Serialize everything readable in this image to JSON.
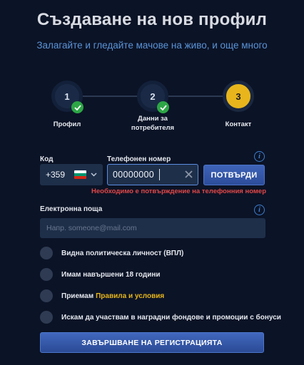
{
  "header": {
    "title": "Създаване на нов профил",
    "subtitle": "Залагайте и гледайте мачове на живо, и още много"
  },
  "steps": [
    {
      "number": "1",
      "label": "Профил",
      "completed": true
    },
    {
      "number": "2",
      "label": "Данни за потребителя",
      "completed": true
    },
    {
      "number": "3",
      "label": "Контакт",
      "active": true
    }
  ],
  "phone": {
    "code_label": "Код",
    "code_value": "+359",
    "number_label": "Телефонен номер",
    "number_value": "00000000",
    "confirm_label": "ПОТВЪРДИ",
    "error": "Необходимо е потвърждение на телефонния номер"
  },
  "email": {
    "label": "Електронна поща",
    "placeholder": "Напр. someone@mail.com"
  },
  "checkboxes": [
    {
      "label": "Видна политическа личност (ВПЛ)"
    },
    {
      "label": "Имам навършени 18 години"
    },
    {
      "label": "Приемам",
      "link": "Правила и условия"
    },
    {
      "label": "Искам да участвам в наградни фондове и промоции с бонуси"
    }
  ],
  "submit_label": "ЗАВЪРШВАНЕ НА РЕГИСТРАЦИЯТА",
  "colors": {
    "background": "#0b1326",
    "accent_blue": "#3e63b8",
    "accent_yellow": "#e8b61c",
    "success_green": "#2da646",
    "error_red": "#e04848"
  },
  "icons": {
    "flag": "bulgaria-flag-icon",
    "clear": "close-icon",
    "info": "info-icon",
    "check": "check-icon",
    "dropdown": "chevron-down-icon"
  }
}
